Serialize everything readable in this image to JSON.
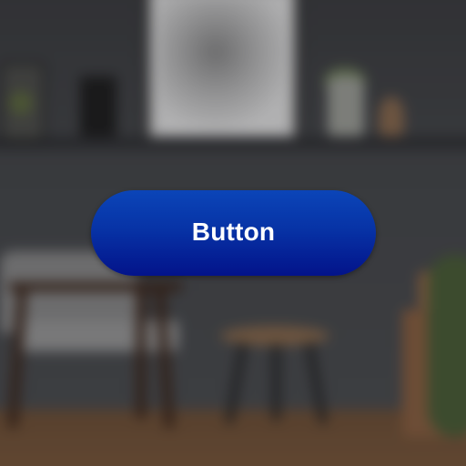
{
  "button": {
    "label": "Button"
  },
  "colors": {
    "button_top": "#0b45b8",
    "button_bottom": "#03138a",
    "label_text": "#ffffff"
  }
}
